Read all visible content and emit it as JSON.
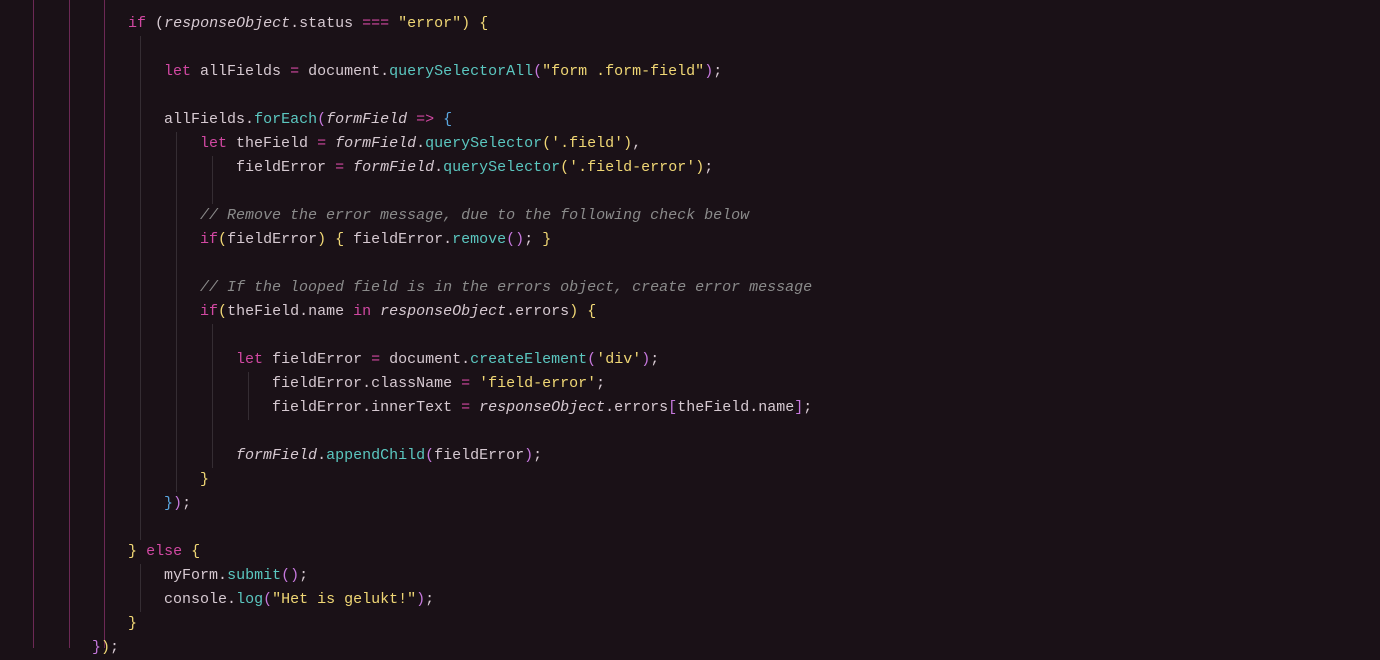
{
  "code": {
    "l1": {
      "if": "if",
      "lp": " (",
      "ro": "responseObject",
      "dot": ".",
      "status": "status ",
      "eq": "=== ",
      "strerr": "\"error\"",
      "rp": ")",
      " ": " ",
      "lb": "{"
    },
    "l2": {
      "let": "let ",
      "all": "allFields ",
      "eq": "= ",
      "doc": "document",
      "dot": ".",
      "qsa": "querySelectorAll",
      "lp": "(",
      "str": "\"form .form-field\"",
      "rp": ")",
      "semi": ";"
    },
    "l3": {
      "all": "allFields",
      "dot": ".",
      "fe": "forEach",
      "lp": "(",
      "ff": "formField ",
      "arr": "=> ",
      "lb": "{"
    },
    "l4": {
      "let": "let ",
      "tf": "theField ",
      "eq": "= ",
      "ff": "formField",
      "dot": ".",
      "qs": "querySelector",
      "lp": "(",
      "str": "'.field'",
      "rp": ")",
      "comma": ","
    },
    "l5": {
      "fe": "fieldError ",
      "eq": "= ",
      "ff": "formField",
      "dot": ".",
      "qs": "querySelector",
      "lp": "(",
      "str": "'.field-error'",
      "rp": ")",
      "semi": ";"
    },
    "l6": {
      "c": "// Remove the error message, due to the following check below"
    },
    "l7": {
      "if": "if",
      "lp": "(",
      "fe": "fieldError",
      "rp": ")",
      " ": " ",
      "lb": "{ ",
      "fe2": "fieldError",
      "dot": ".",
      "rm": "remove",
      "lp2": "()",
      "semi": "; ",
      "rb": "}"
    },
    "l8": {
      "c": "// If the looped field is in the errors object, create error message"
    },
    "l9": {
      "if": "if",
      "lp": "(",
      "tf": "theField",
      "dot": ".",
      "name": "name ",
      "in": "in ",
      "ro": "responseObject",
      "dot2": ".",
      "err": "errors",
      "rp": ")",
      " ": " ",
      "lb": "{"
    },
    "l10": {
      "let": "let ",
      "fe": "fieldError ",
      "eq": "= ",
      "doc": "document",
      "dot": ".",
      "ce": "createElement",
      "lp": "(",
      "str": "'div'",
      "rp": ")",
      "semi": ";"
    },
    "l11": {
      "fe": "fieldError",
      "dot": ".",
      "cn": "className ",
      "eq": "= ",
      "str": "'field-error'",
      "semi": ";"
    },
    "l12": {
      "fe": "fieldError",
      "dot": ".",
      "it": "innerText ",
      "eq": "= ",
      "ro": "responseObject",
      "dot2": ".",
      "err": "errors",
      "lb": "[",
      "tf": "theField",
      "dot3": ".",
      "name": "name",
      "rb": "]",
      "semi": ";"
    },
    "l13": {
      "ff": "formField",
      "dot": ".",
      "ac": "appendChild",
      "lp": "(",
      "fe": "fieldError",
      "rp": ")",
      "semi": ";"
    },
    "l14": {
      "rb": "}"
    },
    "l15": {
      "rb": "}",
      "rp": ")",
      "semi": ";"
    },
    "l16": {
      "rb": "}",
      " ": " ",
      "else": "else ",
      "lb": "{"
    },
    "l17": {
      "mf": "myForm",
      "dot": ".",
      "sub": "submit",
      "lp": "()",
      "semi": ";"
    },
    "l18": {
      "con": "console",
      "dot": ".",
      "log": "log",
      "lp": "(",
      "str": "\"Het is gelukt!\"",
      "rp": ")",
      "semi": ";"
    },
    "l19": {
      "rb": "}"
    },
    "l20": {
      "rb": "}",
      "rp": ")",
      "semi": ";"
    }
  }
}
